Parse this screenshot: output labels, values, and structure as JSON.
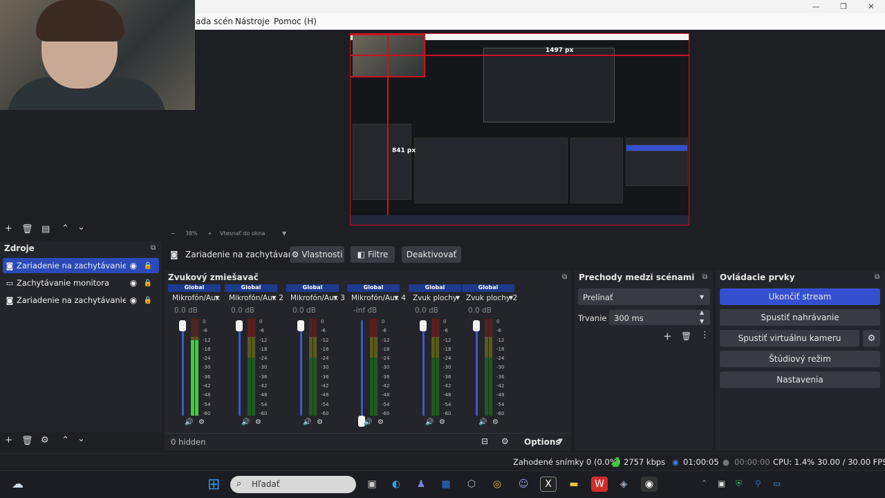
{
  "window": {
    "minimize": "—",
    "restore": "❐",
    "close": "✕"
  },
  "menu": {
    "items": [
      "ada scén",
      "Nástroje",
      "Pomoc (H)"
    ]
  },
  "preview": {
    "width_label": "1497 px",
    "height_label": "841 px"
  },
  "zoom": {
    "minus": "−",
    "value": "38%",
    "plus": "+",
    "fit": "Vtesnať do okna"
  },
  "sources": {
    "title": "Zdroje",
    "items": [
      {
        "label": "Zariadenie na zachytávanie vide",
        "icon": "camera-icon",
        "selected": true
      },
      {
        "label": "Zachytávanie monitora",
        "icon": "monitor-icon",
        "selected": false
      },
      {
        "label": "Zariadenie na zachytávanie vide",
        "icon": "camera-icon",
        "selected": false
      }
    ]
  },
  "source_bar": {
    "name": "Zariadenie na zachytávanie",
    "properties": "Vlastnosti",
    "filters": "Filtre",
    "deactivate": "Deaktivovať"
  },
  "mixer": {
    "title": "Zvukový zmiešavač",
    "hidden": "0 hidden",
    "options": "Options",
    "ticks": [
      "0",
      "-6",
      "-12",
      "-18",
      "-24",
      "-30",
      "-36",
      "-42",
      "-48",
      "-54",
      "-60"
    ],
    "channels": [
      {
        "global": "Global",
        "name": "Mikrofón/Aux",
        "db": "0.0 dB",
        "level": 0.78
      },
      {
        "global": "Global",
        "name": "Mikrofón/Aux 2",
        "db": "0.0 dB",
        "level": 0
      },
      {
        "global": "Global",
        "name": "Mikrofón/Aux 3",
        "db": "0.0 dB",
        "level": 0
      },
      {
        "global": "Global",
        "name": "Mikrofón/Aux 4",
        "db": "-inf dB",
        "level": 0
      },
      {
        "global": "Global",
        "name": "Zvuk plochy",
        "db": "0.0 dB",
        "level": 0
      },
      {
        "global": "Global",
        "name": "Zvuk plochy 2",
        "db": "0.0 dB",
        "level": 0
      }
    ]
  },
  "transitions": {
    "title": "Prechody medzi scénami",
    "selected": "Prelínať",
    "duration_label": "Trvanie",
    "duration": "300 ms"
  },
  "controls": {
    "title": "Ovládacie prvky",
    "stop_stream": "Ukončiť stream",
    "start_recording": "Spustiť nahrávanie",
    "virtual_camera": "Spustiť virtuálnu kameru",
    "studio_mode": "Štúdiový režim",
    "settings": "Nastavenia"
  },
  "status": {
    "dropped": "Zahodené snímky 0 (0.0%)",
    "bitrate": "2757 kbps",
    "stream_time": "01:00:05",
    "rec_time": "00:00:00",
    "cpu": "CPU: 1.4%",
    "fps": "30.00 / 30.00 FPS"
  },
  "taskbar": {
    "search_placeholder": "Hľadať"
  },
  "colors": {
    "accent": "#3450d0",
    "selection": "#2b4ab8",
    "global_badge": "#1d3a8c",
    "preview_border": "#d01020"
  }
}
